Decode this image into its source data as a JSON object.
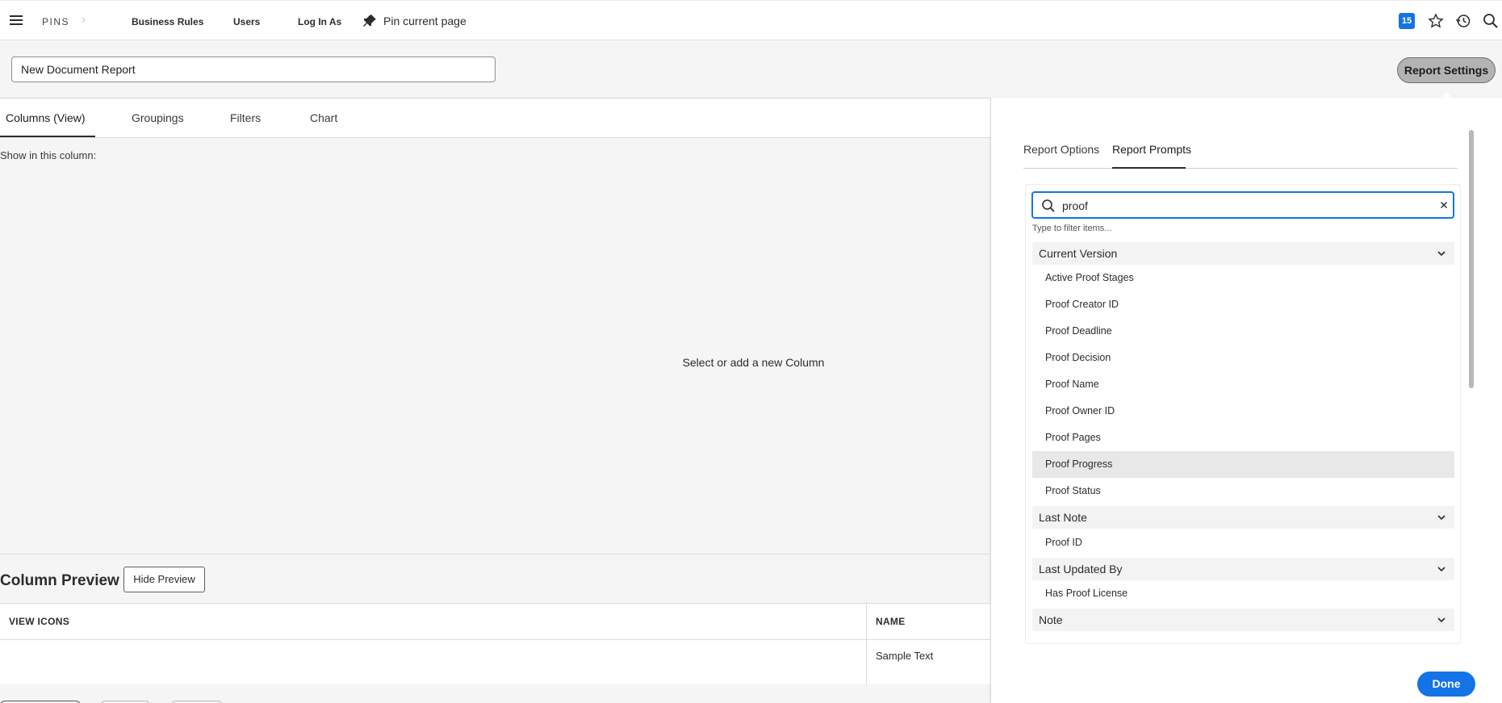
{
  "nav": {
    "brand": "PINS",
    "links": [
      "Business Rules",
      "Users",
      "Log In As"
    ],
    "pin_label": "Pin current page",
    "badge_count": "15"
  },
  "report": {
    "name": "New Document Report",
    "settings_label": "Report Settings"
  },
  "tabs": [
    "Columns (View)",
    "Groupings",
    "Filters",
    "Chart"
  ],
  "main": {
    "show_label": "Show in this column:",
    "empty_message": "Select or add a new Column"
  },
  "preview": {
    "title": "Column Preview",
    "hide_label": "Hide Preview",
    "columns": [
      "VIEW ICONS",
      "NAME"
    ],
    "sample": "Sample Text"
  },
  "panel": {
    "tabs": [
      "Report Options",
      "Report Prompts"
    ],
    "search_value": "proof",
    "hint": "Type to filter items...",
    "groups": [
      {
        "label": "Current Version",
        "items": [
          "Active Proof Stages",
          "Proof Creator ID",
          "Proof Deadline",
          "Proof Decision",
          "Proof Name",
          "Proof Owner ID",
          "Proof Pages",
          "Proof Progress",
          "Proof Status"
        ]
      },
      {
        "label": "Last Note",
        "items": [
          "Proof ID"
        ]
      },
      {
        "label": "Last Updated By",
        "items": [
          "Has Proof License"
        ]
      },
      {
        "label": "Note",
        "items": []
      }
    ],
    "highlighted_item": "Proof Progress",
    "done_label": "Done"
  },
  "colors": {
    "accent": "#1473e6"
  }
}
